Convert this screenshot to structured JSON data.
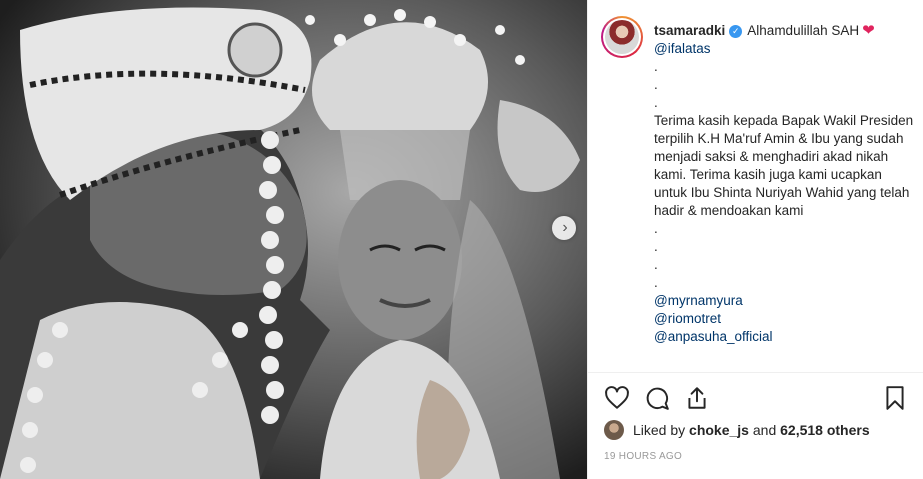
{
  "post": {
    "username": "tsamaradki",
    "caption_first": "Alhamdulillah SAH",
    "caption_heart": "❤",
    "mention_first": "@ifalatas",
    "dots_a": [
      ".",
      ".",
      "."
    ],
    "body": "Terima kasih kepada Bapak Wakil Presiden terpilih K.H Ma'ruf Amin & Ibu yang sudah menjadi saksi & menghadiri akad nikah kami. Terima kasih juga kami ucapkan untuk Ibu Shinta Nuriyah Wahid yang telah hadir & mendoakan kami",
    "dots_b": [
      ".",
      ".",
      ".",
      "."
    ],
    "mentions": [
      "@myrnamyura",
      "@riomotret",
      "@anpasuha_official"
    ],
    "liked_by_prefix": "Liked by",
    "liked_by_user": "choke_js",
    "liked_by_and": "and",
    "liked_by_others": "62,518 others",
    "timestamp": "19 HOURS AGO"
  },
  "icons": {
    "like": "heart-outline-icon",
    "comment": "comment-bubble-icon",
    "share": "share-arrow-icon",
    "save": "bookmark-icon",
    "next": "chevron-right-icon",
    "verified": "verified-badge-icon"
  },
  "colors": {
    "link": "#003569",
    "verified": "#3897f0",
    "timestamp": "#999999",
    "heart": "#e0245e"
  }
}
